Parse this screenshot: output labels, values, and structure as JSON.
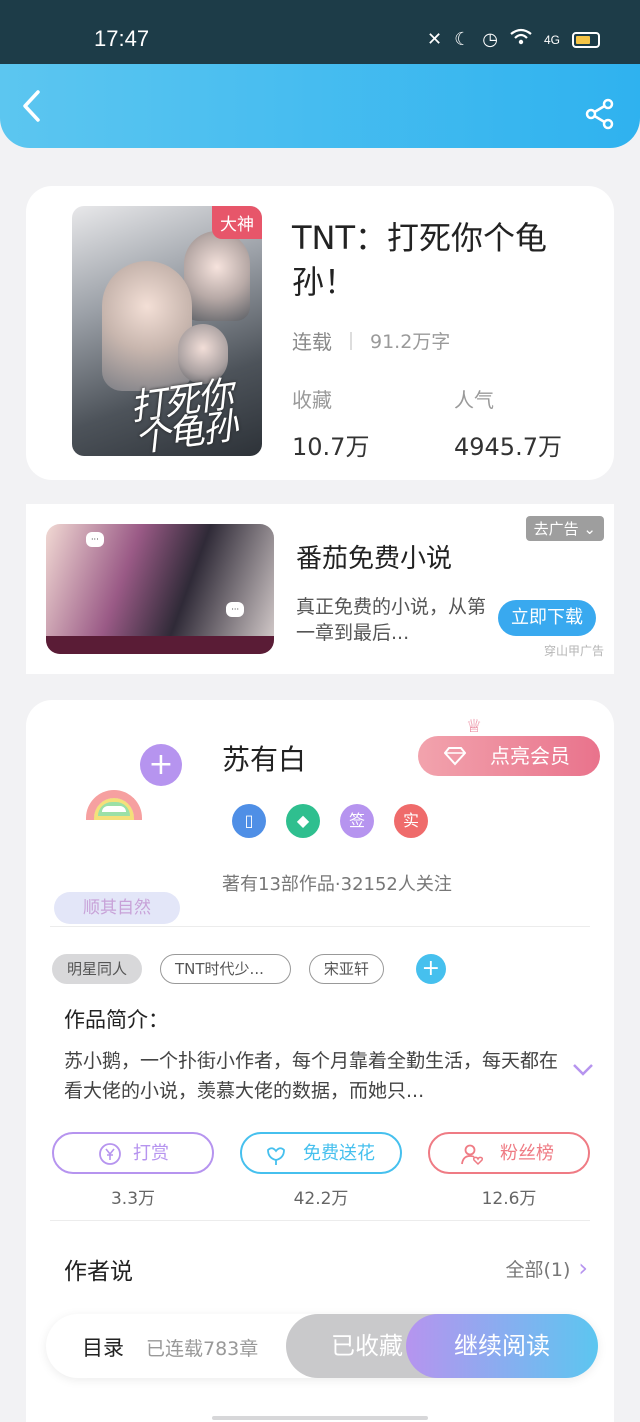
{
  "status_bar": {
    "time": "17:47",
    "network": "4G",
    "icons": [
      "vibrate-off-icon",
      "moon-icon",
      "alarm-icon",
      "wifi-icon",
      "signal-icon",
      "battery-icon"
    ]
  },
  "app_bar": {
    "back_icon": "back-arrow-icon",
    "share_icon": "share-icon",
    "accent_color": "#2fb2ef"
  },
  "book": {
    "badge": "大神",
    "cover_title": "打死你个龟孙",
    "title": "TNT：打死你个龟孙！",
    "status": "连载",
    "word_count": "91.2万字",
    "stats": [
      {
        "label": "收藏",
        "value": "10.7万"
      },
      {
        "label": "人气",
        "value": "4945.7万"
      }
    ]
  },
  "ad": {
    "title": "番茄免费小说",
    "description": "真正免费的小说，从第一章到最后...",
    "close_label": "去广告",
    "button_label": "立即下载",
    "source": "穿山甲广告"
  },
  "author": {
    "name": "苏有白",
    "nickname_tag": "顺其自然",
    "vip_label": "点亮会员",
    "badges": [
      {
        "name": "phone-badge-icon",
        "text": "",
        "color": "#4f8fe6"
      },
      {
        "name": "diamond-badge-icon",
        "text": "",
        "color": "#2fbf8f"
      },
      {
        "name": "sign-badge",
        "text": "签",
        "color": "#b694ef"
      },
      {
        "name": "real-badge",
        "text": "实",
        "color": "#ef6b6b"
      }
    ],
    "stats": "著有13部作品·32152人关注",
    "tags": [
      "明星同人",
      "TNT时代少...",
      "宋亚轩"
    ]
  },
  "intro": {
    "label": "作品简介：",
    "text": "苏小鹅，一个扑街小作者，每个月靠着全勤生活，每天都在看大佬的小说，羡慕大佬的数据，而她只..."
  },
  "actions": [
    {
      "label": "打赏",
      "count": "3.3万",
      "color": "#b694ef"
    },
    {
      "label": "免费送花",
      "count": "42.2万",
      "color": "#46c0ee"
    },
    {
      "label": "粉丝榜",
      "count": "12.6万",
      "color": "#ef7b84"
    }
  ],
  "author_say": {
    "label": "作者说",
    "all_label": "全部(1)"
  },
  "bottom_bar": {
    "toc_label": "目录",
    "chapters_label": "已连载783章",
    "collected_label": "已收藏",
    "continue_label": "继续阅读"
  }
}
